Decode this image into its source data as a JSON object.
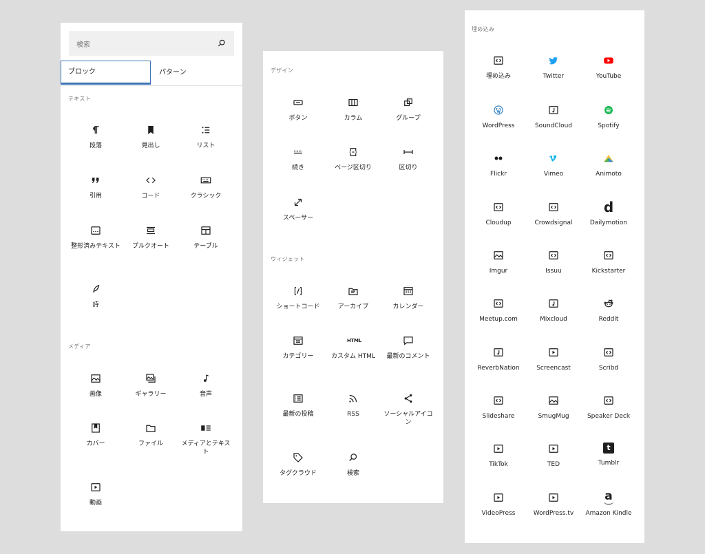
{
  "panel1": {
    "search_placeholder": "検索",
    "tabs": [
      {
        "label": "ブロック",
        "active": true
      },
      {
        "label": "パターン",
        "active": false
      }
    ],
    "sections": [
      {
        "title": "テキスト",
        "items": [
          {
            "label": "段落",
            "icon": "paragraph-icon"
          },
          {
            "label": "見出し",
            "icon": "heading-icon"
          },
          {
            "label": "リスト",
            "icon": "list-icon"
          },
          {
            "label": "引用",
            "icon": "quote-icon"
          },
          {
            "label": "コード",
            "icon": "code-icon"
          },
          {
            "label": "クラシック",
            "icon": "keyboard-icon"
          },
          {
            "label": "整形済みテキスト",
            "icon": "preformatted-icon"
          },
          {
            "label": "プルクオート",
            "icon": "pullquote-icon"
          },
          {
            "label": "テーブル",
            "icon": "table-icon"
          },
          {
            "label": "詩",
            "icon": "verse-icon"
          }
        ]
      },
      {
        "title": "メディア",
        "items": [
          {
            "label": "画像",
            "icon": "image-icon"
          },
          {
            "label": "ギャラリー",
            "icon": "gallery-icon"
          },
          {
            "label": "音声",
            "icon": "audio-icon"
          },
          {
            "label": "カバー",
            "icon": "cover-icon"
          },
          {
            "label": "ファイル",
            "icon": "file-icon"
          },
          {
            "label": "メディアとテキスト",
            "icon": "media-text-icon"
          },
          {
            "label": "動画",
            "icon": "video-icon"
          }
        ]
      }
    ]
  },
  "panel2": {
    "sections": [
      {
        "title": "デザイン",
        "items": [
          {
            "label": "ボタン",
            "icon": "button-icon"
          },
          {
            "label": "カラム",
            "icon": "columns-icon"
          },
          {
            "label": "グループ",
            "icon": "group-icon"
          },
          {
            "label": "続き",
            "icon": "more-icon"
          },
          {
            "label": "ページ区切り",
            "icon": "page-break-icon"
          },
          {
            "label": "区切り",
            "icon": "separator-icon"
          },
          {
            "label": "スペーサー",
            "icon": "spacer-icon"
          }
        ]
      },
      {
        "title": "ウィジェット",
        "items": [
          {
            "label": "ショートコード",
            "icon": "shortcode-icon"
          },
          {
            "label": "アーカイブ",
            "icon": "archive-icon"
          },
          {
            "label": "カレンダー",
            "icon": "calendar-icon"
          },
          {
            "label": "カテゴリー",
            "icon": "categories-icon"
          },
          {
            "label": "カスタム HTML",
            "icon": "html-icon",
            "icon_text": "HTML"
          },
          {
            "label": "最新のコメント",
            "icon": "comment-icon"
          },
          {
            "label": "最新の投稿",
            "icon": "latest-posts-icon"
          },
          {
            "label": "RSS",
            "icon": "rss-icon"
          },
          {
            "label": "ソーシャルアイコン",
            "icon": "share-icon"
          },
          {
            "label": "タグクラウド",
            "icon": "tag-icon"
          },
          {
            "label": "検索",
            "icon": "search-icon"
          }
        ]
      }
    ]
  },
  "panel3": {
    "sections": [
      {
        "title": "埋め込み",
        "items": [
          {
            "label": "埋め込み",
            "icon": "embed-icon"
          },
          {
            "label": "Twitter",
            "icon": "twitter-icon"
          },
          {
            "label": "YouTube",
            "icon": "youtube-icon"
          },
          {
            "label": "WordPress",
            "icon": "wordpress-icon"
          },
          {
            "label": "SoundCloud",
            "icon": "soundcloud-icon"
          },
          {
            "label": "Spotify",
            "icon": "spotify-icon"
          },
          {
            "label": "Flickr",
            "icon": "flickr-icon"
          },
          {
            "label": "Vimeo",
            "icon": "vimeo-icon"
          },
          {
            "label": "Animoto",
            "icon": "animoto-icon"
          },
          {
            "label": "Cloudup",
            "icon": "embed-icon"
          },
          {
            "label": "Crowdsignal",
            "icon": "embed-icon"
          },
          {
            "label": "Dailymotion",
            "icon": "dailymotion-icon",
            "icon_text": "d"
          },
          {
            "label": "Imgur",
            "icon": "image-icon"
          },
          {
            "label": "Issuu",
            "icon": "embed-icon"
          },
          {
            "label": "Kickstarter",
            "icon": "embed-icon"
          },
          {
            "label": "Meetup.com",
            "icon": "embed-icon"
          },
          {
            "label": "Mixcloud",
            "icon": "audio-embed-icon"
          },
          {
            "label": "Reddit",
            "icon": "reddit-icon"
          },
          {
            "label": "ReverbNation",
            "icon": "audio-embed-icon"
          },
          {
            "label": "Screencast",
            "icon": "video-icon"
          },
          {
            "label": "Scribd",
            "icon": "embed-icon"
          },
          {
            "label": "Slideshare",
            "icon": "embed-icon"
          },
          {
            "label": "SmugMug",
            "icon": "image-icon"
          },
          {
            "label": "Speaker Deck",
            "icon": "embed-icon"
          },
          {
            "label": "TikTok",
            "icon": "video-icon"
          },
          {
            "label": "TED",
            "icon": "video-icon"
          },
          {
            "label": "Tumblr",
            "icon": "tumblr-icon",
            "icon_text": "t"
          },
          {
            "label": "VideoPress",
            "icon": "video-icon"
          },
          {
            "label": "WordPress.tv",
            "icon": "video-icon"
          },
          {
            "label": "Amazon Kindle",
            "icon": "amazon-icon",
            "icon_text": "a"
          }
        ]
      }
    ]
  },
  "colors": {
    "background": "#dddddd",
    "panel": "#ffffff",
    "text": "#1e1e1e",
    "muted": "#757575",
    "accent": "#3b74b7",
    "twitter": "#1da1f2",
    "youtube": "#ff0000",
    "wordpress": "#3582c4",
    "spotify": "#1db954",
    "vimeo": "#1ab7ea"
  }
}
